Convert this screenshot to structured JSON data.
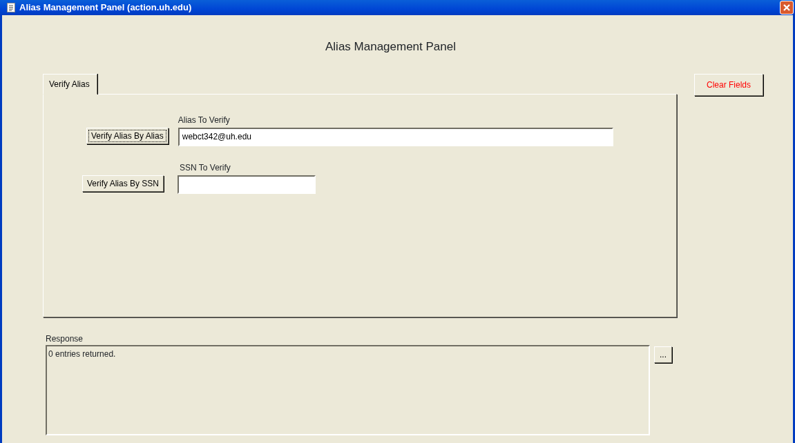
{
  "window": {
    "title": "Alias Management Panel (action.uh.edu)"
  },
  "heading": "Alias Management Panel",
  "tabs": [
    {
      "label": "Verify Alias",
      "selected": true
    }
  ],
  "clear_button": "Clear Fields",
  "rows": [
    {
      "button": "Verify Alias By Alias",
      "focused": true,
      "field_label": "Alias To Verify",
      "value": "webct342@uh.edu",
      "wide": true
    },
    {
      "button": "Verify Alias By SSN",
      "focused": false,
      "field_label": "SSN To Verify",
      "value": "",
      "wide": false
    }
  ],
  "response": {
    "label": "Response",
    "text": "0 entries returned.",
    "more_button": "..."
  }
}
